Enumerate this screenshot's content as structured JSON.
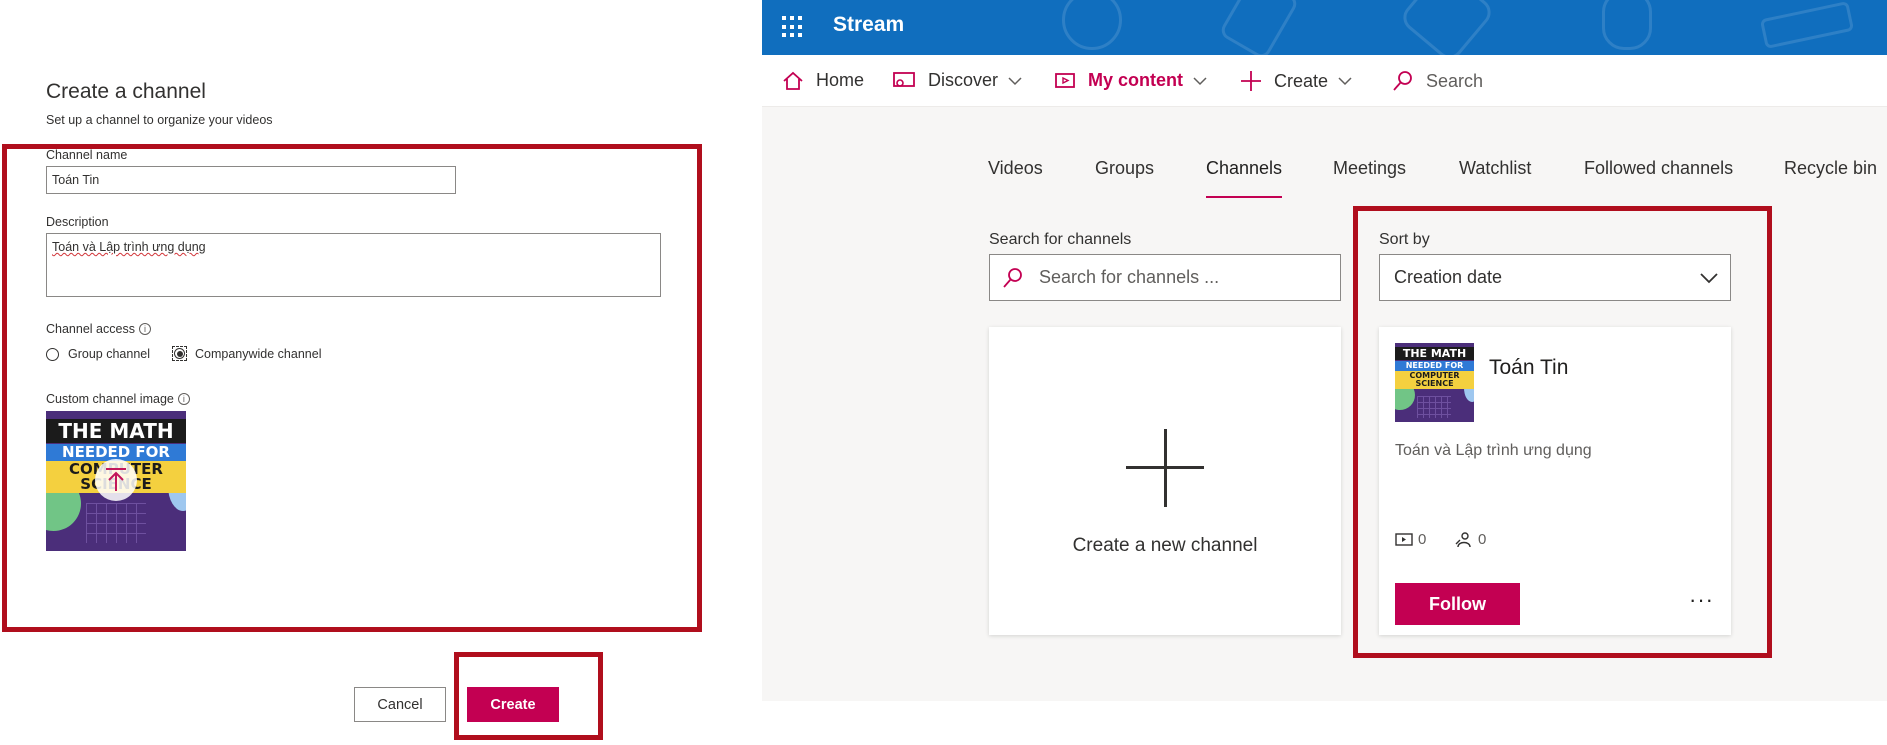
{
  "create_dialog": {
    "title": "Create a channel",
    "subtitle": "Set up a channel to organize your videos",
    "name_label": "Channel name",
    "name_value": "Toán Tin",
    "description_label": "Description",
    "description_value": "Toán và Lập trình ưng dụng",
    "access_label": "Channel access",
    "access_options": [
      "Group channel",
      "Companywide channel"
    ],
    "access_selected": "Companywide channel",
    "image_label": "Custom channel image",
    "image_text": [
      "THE MATH",
      "NEEDED FOR",
      "COMPUTER SCIENCE"
    ],
    "cancel_label": "Cancel",
    "create_label": "Create"
  },
  "stream": {
    "app_name": "Stream",
    "nav": {
      "home": "Home",
      "discover": "Discover",
      "my_content": "My content",
      "create": "Create",
      "search": "Search"
    },
    "tabs": [
      "Videos",
      "Groups",
      "Channels",
      "Meetings",
      "Watchlist",
      "Followed channels",
      "Recycle bin"
    ],
    "active_tab": "Channels",
    "search_label": "Search for channels",
    "search_placeholder": "Search for channels ...",
    "sort_label": "Sort by",
    "sort_value": "Creation date",
    "new_channel_label": "Create a new channel",
    "channel": {
      "title": "Toán Tin",
      "description": "Toán và Lập trình ưng dụng",
      "videos_count": "0",
      "followers_count": "0",
      "follow_label": "Follow",
      "more_label": "···"
    }
  },
  "colors": {
    "accent": "#c30052",
    "topbar": "#106ebe",
    "highlight": "#b00e1d"
  }
}
